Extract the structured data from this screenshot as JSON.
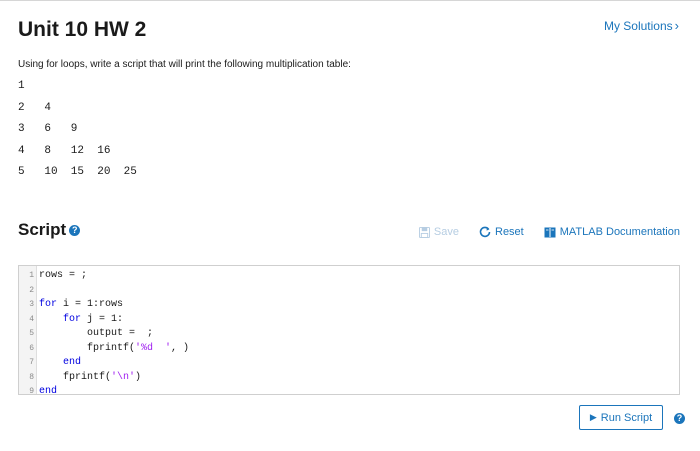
{
  "page": {
    "title": "Unit 10 HW 2",
    "my_solutions": "My Solutions"
  },
  "problem": {
    "prompt": "Using for loops, write a script that will print the following multiplication table:",
    "table_rows": [
      "1",
      "2   4",
      "3   6   9",
      "4   8   12  16",
      "5   10  15  20  25"
    ]
  },
  "script_section": {
    "heading": "Script",
    "help_icon": "question-circle-icon",
    "toolbar": {
      "save_label": "Save",
      "save_icon": "floppy-disk-icon",
      "reset_label": "Reset",
      "reset_icon": "refresh-icon",
      "doc_label": "MATLAB Documentation",
      "doc_icon": "book-icon"
    }
  },
  "editor": {
    "lines": [
      {
        "num": "1",
        "segments": [
          {
            "t": "rows = ;",
            "c": "plain"
          }
        ]
      },
      {
        "num": "2",
        "segments": []
      },
      {
        "num": "3",
        "segments": [
          {
            "t": "for",
            "c": "kw"
          },
          {
            "t": " i = 1:rows",
            "c": "plain"
          }
        ]
      },
      {
        "num": "4",
        "segments": [
          {
            "t": "    ",
            "c": "plain"
          },
          {
            "t": "for",
            "c": "kw"
          },
          {
            "t": " j = 1:",
            "c": "plain"
          }
        ]
      },
      {
        "num": "5",
        "segments": [
          {
            "t": "        output =  ;",
            "c": "plain"
          }
        ]
      },
      {
        "num": "6",
        "segments": [
          {
            "t": "        fprintf(",
            "c": "plain"
          },
          {
            "t": "'%d  '",
            "c": "str"
          },
          {
            "t": ", )",
            "c": "plain"
          }
        ]
      },
      {
        "num": "7",
        "segments": [
          {
            "t": "    ",
            "c": "plain"
          },
          {
            "t": "end",
            "c": "kw"
          }
        ]
      },
      {
        "num": "8",
        "segments": [
          {
            "t": "    fprintf(",
            "c": "plain"
          },
          {
            "t": "'\\n'",
            "c": "str"
          },
          {
            "t": ")",
            "c": "plain"
          }
        ]
      },
      {
        "num": "9",
        "segments": [
          {
            "t": "end",
            "c": "kw"
          }
        ]
      }
    ]
  },
  "run": {
    "label": "Run Script",
    "icon": "play-icon",
    "help_icon": "question-circle-icon"
  },
  "colors": {
    "accent": "#1b75bb",
    "keyword": "#0000e0",
    "string": "#a020f0"
  }
}
